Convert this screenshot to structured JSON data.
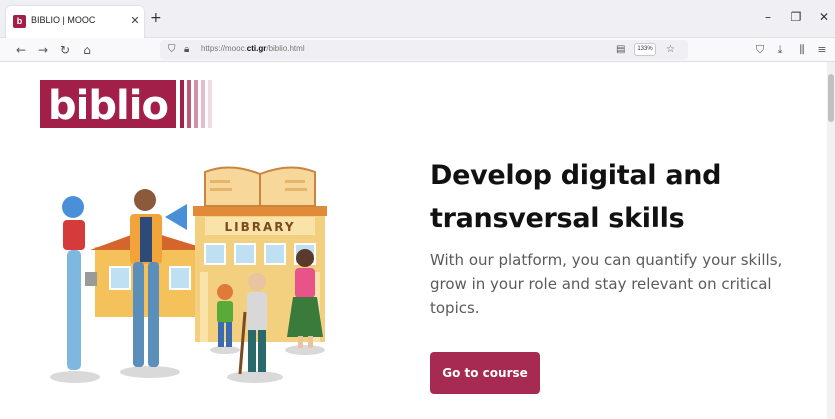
{
  "browser": {
    "tab_title": "BIBLIO | MOOC",
    "favicon_letter": "b",
    "url_prefix": "https://mooc.",
    "url_domain": "cti.gr",
    "url_path": "/biblio.html",
    "zoom": "133%"
  },
  "hero": {
    "logo_text": "biblio",
    "library_sign": "LIBRARY",
    "headline": "Develop digital and transversal skills",
    "subtext": "With our platform, you can quantify your skills, grow in your role and stay relevant on critical topics.",
    "cta_label": "Go to course"
  },
  "colors": {
    "brand": "#a21f4a",
    "cta": "#a62a52"
  },
  "icons": {
    "back": "arrow-left-icon",
    "forward": "arrow-right-icon",
    "reload": "reload-icon",
    "home": "home-icon",
    "shield": "shield-icon",
    "lock": "lock-icon",
    "reader": "reader-view-icon",
    "bookmark": "star-icon",
    "pocket": "pocket-icon",
    "downloads": "download-icon",
    "library": "library-icon",
    "menu": "hamburger-menu-icon"
  }
}
